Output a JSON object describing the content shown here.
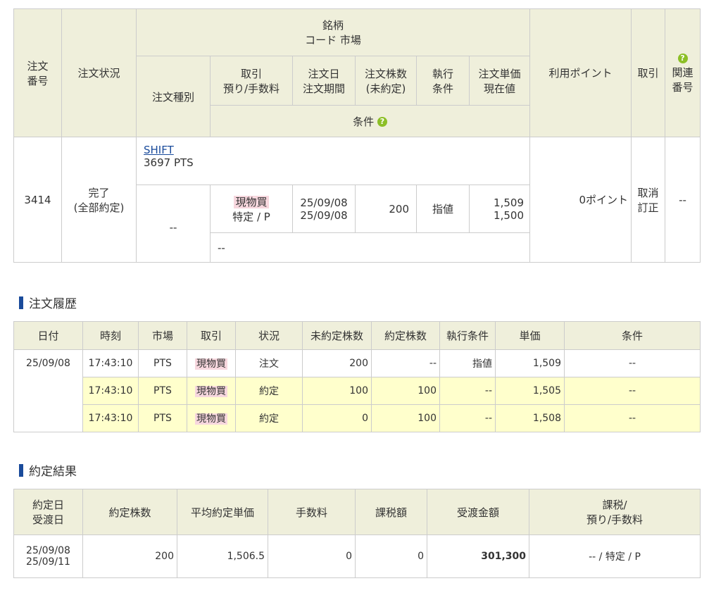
{
  "order_table": {
    "headers": {
      "order_no": [
        "注文",
        "番号"
      ],
      "status": "注文状況",
      "brand": [
        "銘柄",
        "コード  市場"
      ],
      "order_type": "注文種別",
      "trade": [
        "取引",
        "預り/手数料"
      ],
      "order_date": [
        "注文日",
        "注文期間"
      ],
      "shares": [
        "注文株数",
        "(未約定)"
      ],
      "exec_cond": [
        "執行",
        "条件"
      ],
      "price": [
        "注文単価",
        "現在値"
      ],
      "condition": "条件",
      "points": "利用ポイント",
      "action": "取引",
      "related": [
        "関連",
        "番号"
      ]
    },
    "row": {
      "order_no": "3414",
      "status": [
        "完了",
        "(全部約定)"
      ],
      "brand_name": "SHIFT",
      "brand_code": "3697   PTS",
      "order_type": "--",
      "trade_tag": "現物買",
      "trade_sub": "特定 / P",
      "order_date": "25/09/08",
      "order_period": "25/09/08",
      "shares": "200",
      "exec_cond": "指値",
      "price": "1,509",
      "current": "1,500",
      "condition": "--",
      "points": "0ポイント",
      "action_cancel": "取消",
      "action_modify": "訂正",
      "related": "--"
    }
  },
  "history": {
    "title": "注文履歴",
    "columns": [
      "日付",
      "時刻",
      "市場",
      "取引",
      "状況",
      "未約定株数",
      "約定株数",
      "執行条件",
      "単価",
      "条件"
    ],
    "date": "25/09/08",
    "rows": [
      {
        "time": "17:43:10",
        "market": "PTS",
        "trade": "現物買",
        "status": "注文",
        "unfilled": "200",
        "filled": "--",
        "exec": "指値",
        "price": "1,509",
        "cond": "--"
      },
      {
        "time": "17:43:10",
        "market": "PTS",
        "trade": "現物買",
        "status": "約定",
        "unfilled": "100",
        "filled": "100",
        "exec": "--",
        "price": "1,505",
        "cond": "--"
      },
      {
        "time": "17:43:10",
        "market": "PTS",
        "trade": "現物買",
        "status": "約定",
        "unfilled": "0",
        "filled": "100",
        "exec": "--",
        "price": "1,508",
        "cond": "--"
      }
    ]
  },
  "result": {
    "title": "約定結果",
    "columns": {
      "dates": [
        "約定日",
        "受渡日"
      ],
      "shares": "約定株数",
      "avg_price": "平均約定単価",
      "fee": "手数料",
      "tax": "課税額",
      "amount": "受渡金額",
      "tax_type": [
        "課税/",
        "預り/手数料"
      ]
    },
    "row": {
      "exec_date": "25/09/08",
      "settle_date": "25/09/11",
      "shares": "200",
      "avg_price": "1,506.5",
      "fee": "0",
      "tax": "0",
      "amount": "301,300",
      "tax_type": "-- / 特定 / P"
    }
  },
  "colors": {
    "header_bg": "#efefdb",
    "highlight": "#ffffcc",
    "tag": "#f7d7de",
    "accent": "#1a4b9b",
    "help_icon": "#8cbf26"
  },
  "icons": {
    "help": "help-icon",
    "section": "section-bar-icon"
  }
}
